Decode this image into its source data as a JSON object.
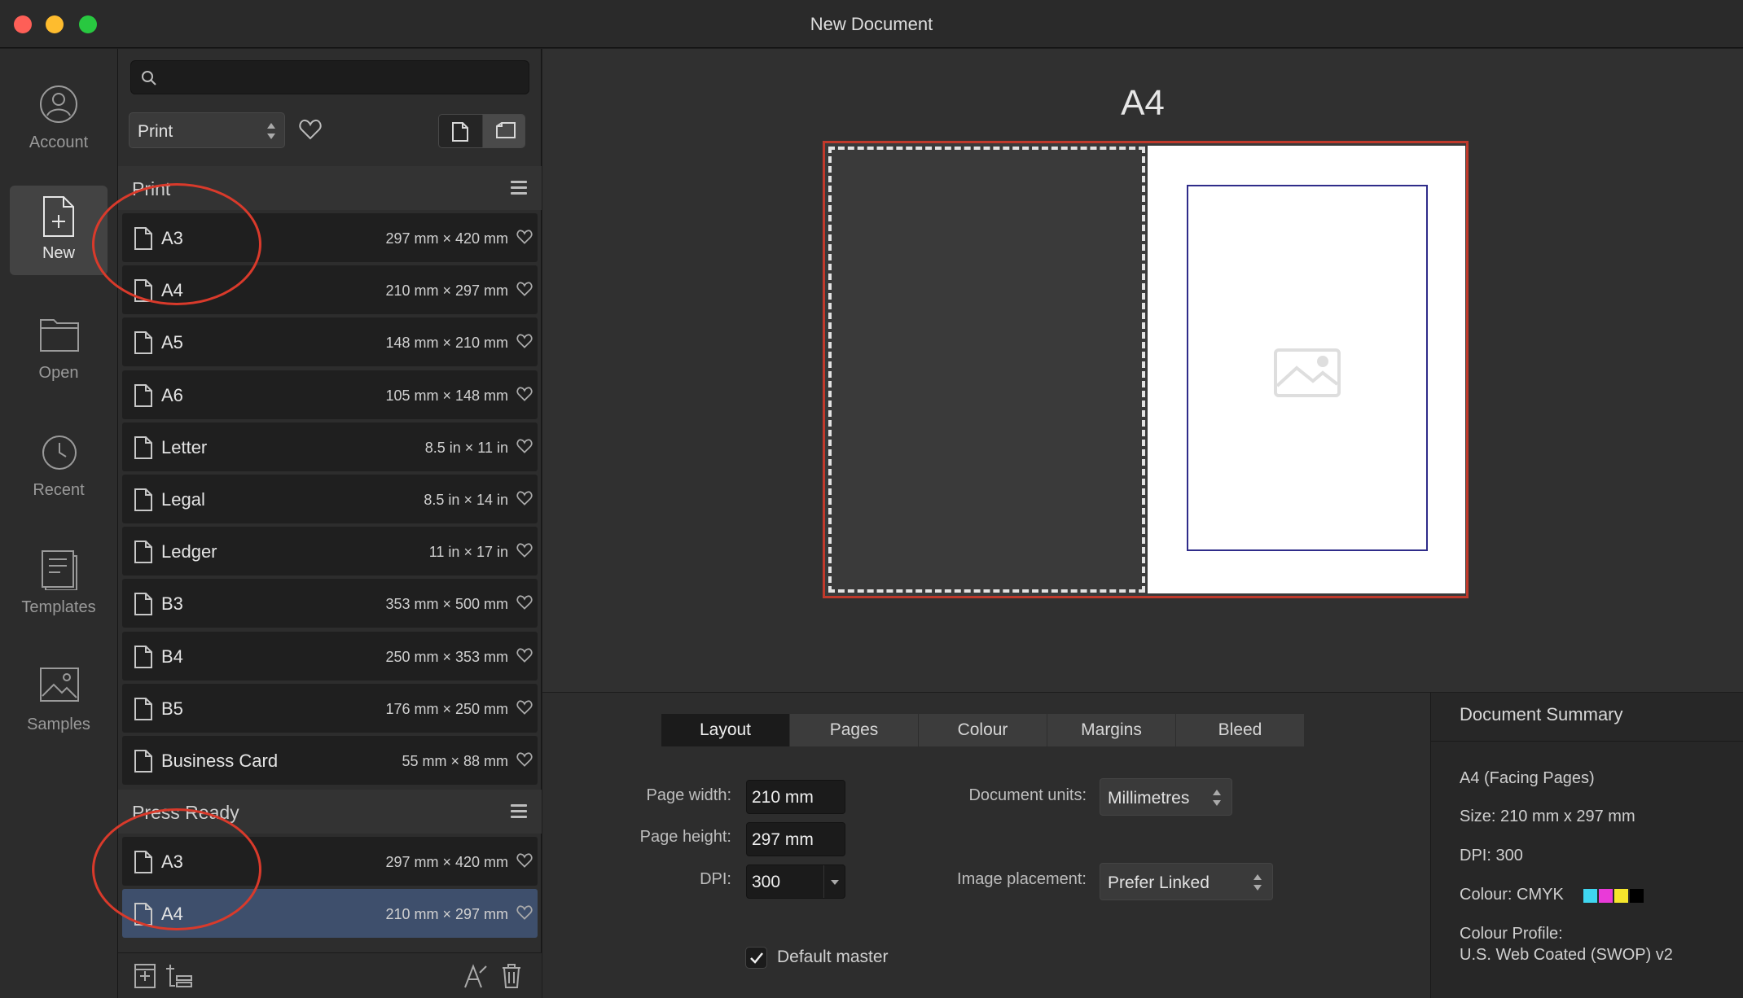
{
  "window": {
    "title": "New Document"
  },
  "rail": {
    "items": [
      {
        "label": "Account"
      },
      {
        "label": "New"
      },
      {
        "label": "Open"
      },
      {
        "label": "Recent"
      },
      {
        "label": "Templates"
      },
      {
        "label": "Samples"
      }
    ]
  },
  "panel": {
    "search": {
      "value": "",
      "placeholder": ""
    },
    "category": {
      "value": "Print"
    },
    "groups": [
      {
        "title": "Print",
        "presets": [
          {
            "name": "A3",
            "size": "297 mm × 420 mm"
          },
          {
            "name": "A4",
            "size": "210 mm × 297 mm"
          },
          {
            "name": "A5",
            "size": "148 mm × 210 mm"
          },
          {
            "name": "A6",
            "size": "105 mm × 148 mm"
          },
          {
            "name": "Letter",
            "size": "8.5 in × 11 in"
          },
          {
            "name": "Legal",
            "size": "8.5 in × 14 in"
          },
          {
            "name": "Ledger",
            "size": "11 in × 17 in"
          },
          {
            "name": "B3",
            "size": "353 mm × 500 mm"
          },
          {
            "name": "B4",
            "size": "250 mm × 353 mm"
          },
          {
            "name": "B5",
            "size": "176 mm × 250 mm"
          },
          {
            "name": "Business Card",
            "size": "55 mm × 88 mm"
          }
        ]
      },
      {
        "title": "Press Ready",
        "presets": [
          {
            "name": "A3",
            "size": "297 mm × 420 mm"
          },
          {
            "name": "A4",
            "size": "210 mm × 297 mm",
            "selected": true
          }
        ]
      }
    ]
  },
  "preview": {
    "title": "A4"
  },
  "tabs": [
    "Layout",
    "Pages",
    "Colour",
    "Margins",
    "Bleed"
  ],
  "active_tab": "Layout",
  "layout": {
    "page_width_label": "Page width:",
    "page_width": "210 mm",
    "page_height_label": "Page height:",
    "page_height": "297 mm",
    "dpi_label": "DPI:",
    "dpi": "300",
    "document_units_label": "Document units:",
    "document_units": "Millimetres",
    "image_placement_label": "Image placement:",
    "image_placement": "Prefer Linked",
    "default_master_label": "Default master",
    "default_master_checked": true
  },
  "summary": {
    "title": "Document Summary",
    "doc": "A4 (Facing Pages)",
    "size": "Size: 210 mm x 297 mm",
    "dpi": "DPI:  300",
    "colour": "Colour: CMYK",
    "profile_label": "Colour Profile:",
    "profile": "U.S. Web Coated (SWOP) v2",
    "swatches": [
      "#3fd6f0",
      "#e93ad8",
      "#f5e62c",
      "#000000"
    ]
  },
  "colors": {
    "accent_selection": "#3e4f6c",
    "annotation": "#d93a2b",
    "bleed_outline": "#c0392b",
    "margin_guide": "#2f2c8a"
  }
}
